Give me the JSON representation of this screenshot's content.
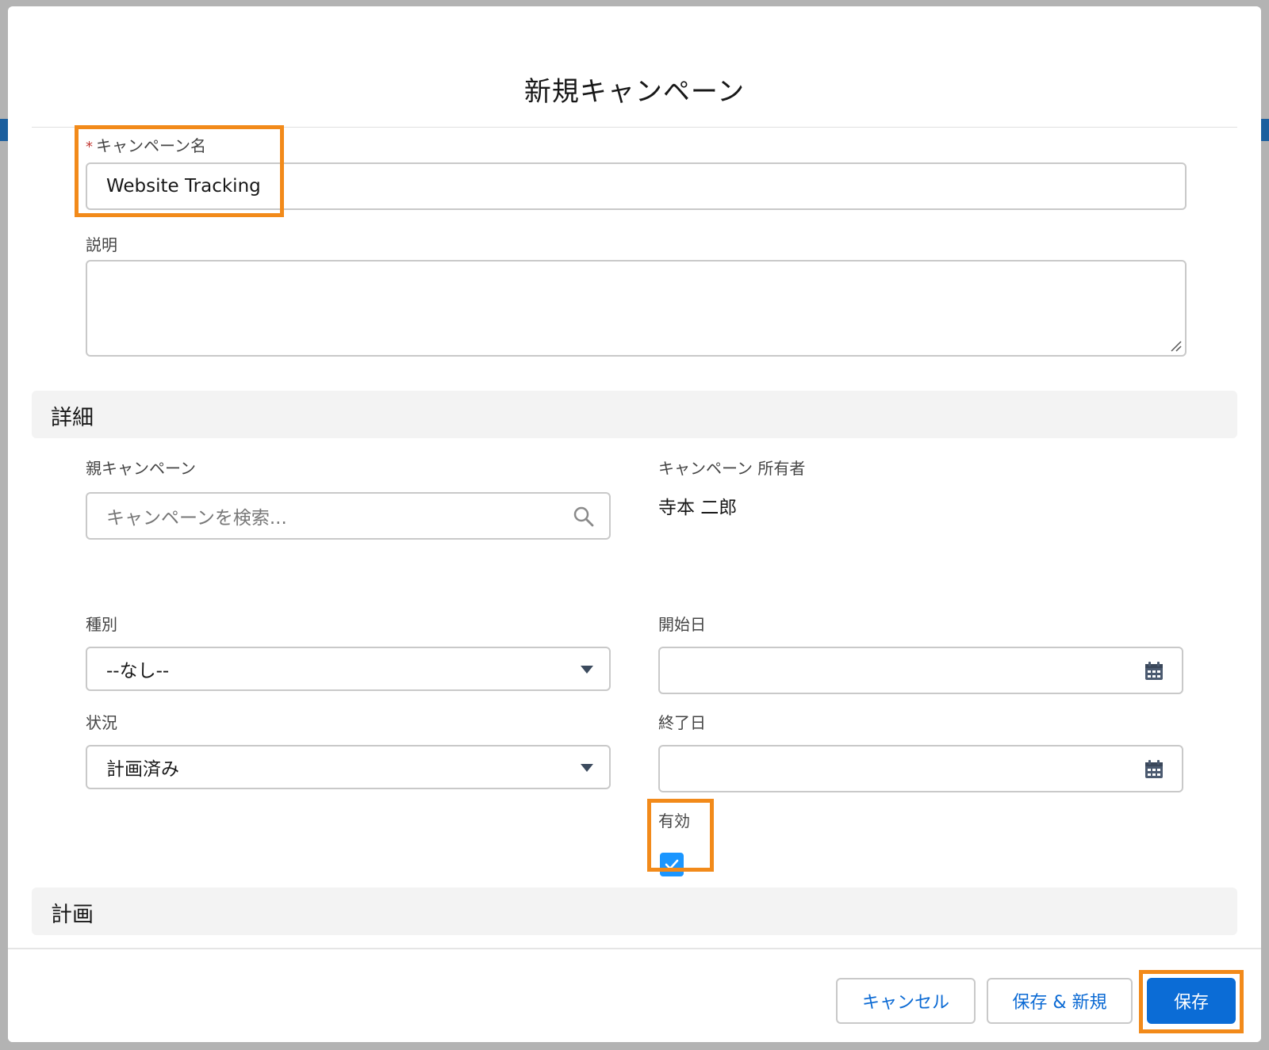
{
  "modal": {
    "title": "新規キャンペーン"
  },
  "campaign_name": {
    "required_mark": "*",
    "label": "キャンペーン名",
    "value": "Website Tracking"
  },
  "description": {
    "label": "説明",
    "value": ""
  },
  "sections": {
    "details_title": "詳細",
    "plan_title": "計画"
  },
  "parent_campaign": {
    "label": "親キャンペーン",
    "placeholder": "キャンペーンを検索..."
  },
  "owner": {
    "label": "キャンペーン 所有者",
    "value": "寺本 二郎"
  },
  "type": {
    "label": "種別",
    "selected": "--なし--"
  },
  "start_date": {
    "label": "開始日",
    "value": ""
  },
  "status": {
    "label": "状況",
    "selected": "計画済み"
  },
  "end_date": {
    "label": "終了日",
    "value": ""
  },
  "active": {
    "label": "有効",
    "checked": true
  },
  "footer": {
    "cancel_label": "キャンセル",
    "save_new_label": "保存 & 新規",
    "save_label": "保存"
  },
  "colors": {
    "brand_blue": "#0b6cd6",
    "checkbox_blue": "#1b96ff",
    "highlight_orange": "#f28a1a",
    "required_red": "#c23934"
  },
  "icons": {
    "search": "search-icon",
    "calendar": "calendar-icon",
    "dropdown": "chevron-down-icon",
    "check": "check-icon"
  }
}
